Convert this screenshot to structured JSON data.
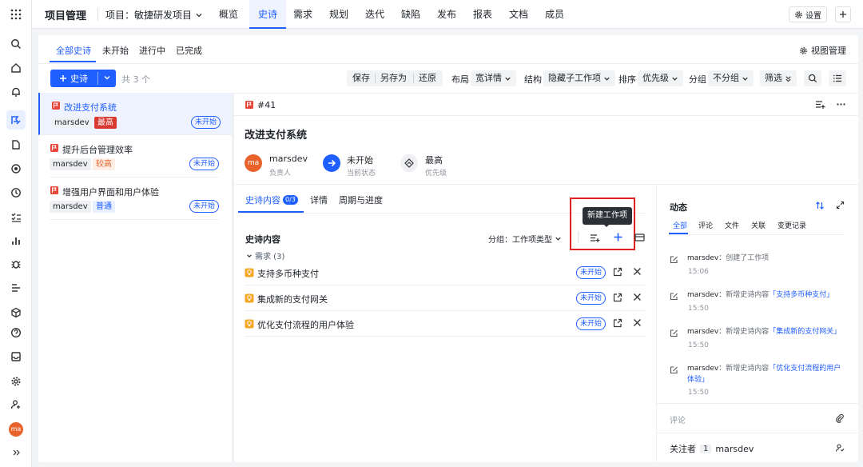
{
  "app": {
    "title": "项目管理",
    "project_label": "项目：敏捷研发项目",
    "settings_label": "设置"
  },
  "topnav": [
    "概览",
    "史诗",
    "需求",
    "规划",
    "迭代",
    "缺陷",
    "发布",
    "报表",
    "文档",
    "成员"
  ],
  "avatar_initials": "ma",
  "filters": {
    "tabs": [
      "全部史诗",
      "未开始",
      "进行中",
      "已完成"
    ],
    "view_manage": "视图管理"
  },
  "toolbar": {
    "new_button": "史诗",
    "count": "共 3 个",
    "save": "保存",
    "save_as": "另存为",
    "restore": "还原",
    "layout_label": "布局",
    "layout_value": "宽详情",
    "structure_label": "结构",
    "structure_value": "隐藏子工作项",
    "sort_label": "排序",
    "sort_value": "优先级",
    "group_label": "分组",
    "group_value": "不分组",
    "filter_label": "筛选"
  },
  "epics": [
    {
      "title": "改进支付系统",
      "owner": "marsdev",
      "priority": "最高",
      "status": "未开始"
    },
    {
      "title": "提升后台管理效率",
      "owner": "marsdev",
      "priority": "较高",
      "status": "未开始"
    },
    {
      "title": "增强用户界面和用户体验",
      "owner": "marsdev",
      "priority": "普通",
      "status": "未开始"
    }
  ],
  "detail": {
    "id": "#41",
    "title": "改进支付系统",
    "owner": {
      "name": "marsdev",
      "label": "负责人"
    },
    "state": {
      "value": "未开始",
      "label": "当前状态"
    },
    "priority": {
      "value": "最高",
      "label": "优先级"
    },
    "tabs": {
      "content": "史诗内容",
      "content_badge": "0/3",
      "detail": "详情",
      "cycle": "周期与进度"
    },
    "section_title": "史诗内容",
    "group_by": "分组：工作项类型",
    "tooltip": "新建工作项",
    "group_header": "需求 (3)",
    "children": [
      {
        "title": "支持多币种支付",
        "status": "未开始"
      },
      {
        "title": "集成新的支付网关",
        "status": "未开始"
      },
      {
        "title": "优化支付流程的用户体验",
        "status": "未开始"
      }
    ]
  },
  "activity": {
    "title": "动态",
    "tabs": [
      "全部",
      "评论",
      "文件",
      "关联",
      "变更记录"
    ],
    "items": [
      {
        "user": "marsdev",
        "text": "：创建了工作项",
        "link": "",
        "time": "15:06"
      },
      {
        "user": "marsdev",
        "text": "：新增史诗内容",
        "link": "「支持多币种支付」",
        "time": "15:50"
      },
      {
        "user": "marsdev",
        "text": "：新增史诗内容",
        "link": "「集成新的支付网关」",
        "time": "15:50"
      },
      {
        "user": "marsdev",
        "text": "：新增史诗内容",
        "link": "「优化支付流程的用户",
        "link2": "体验」",
        "time": "15:50"
      }
    ],
    "comment_placeholder": "评论",
    "followers_label": "关注者",
    "followers_count": "1",
    "follower": "marsdev"
  },
  "colors": {
    "accent": "#1f5eff",
    "danger": "#d83931",
    "red_box": "#e02020"
  }
}
